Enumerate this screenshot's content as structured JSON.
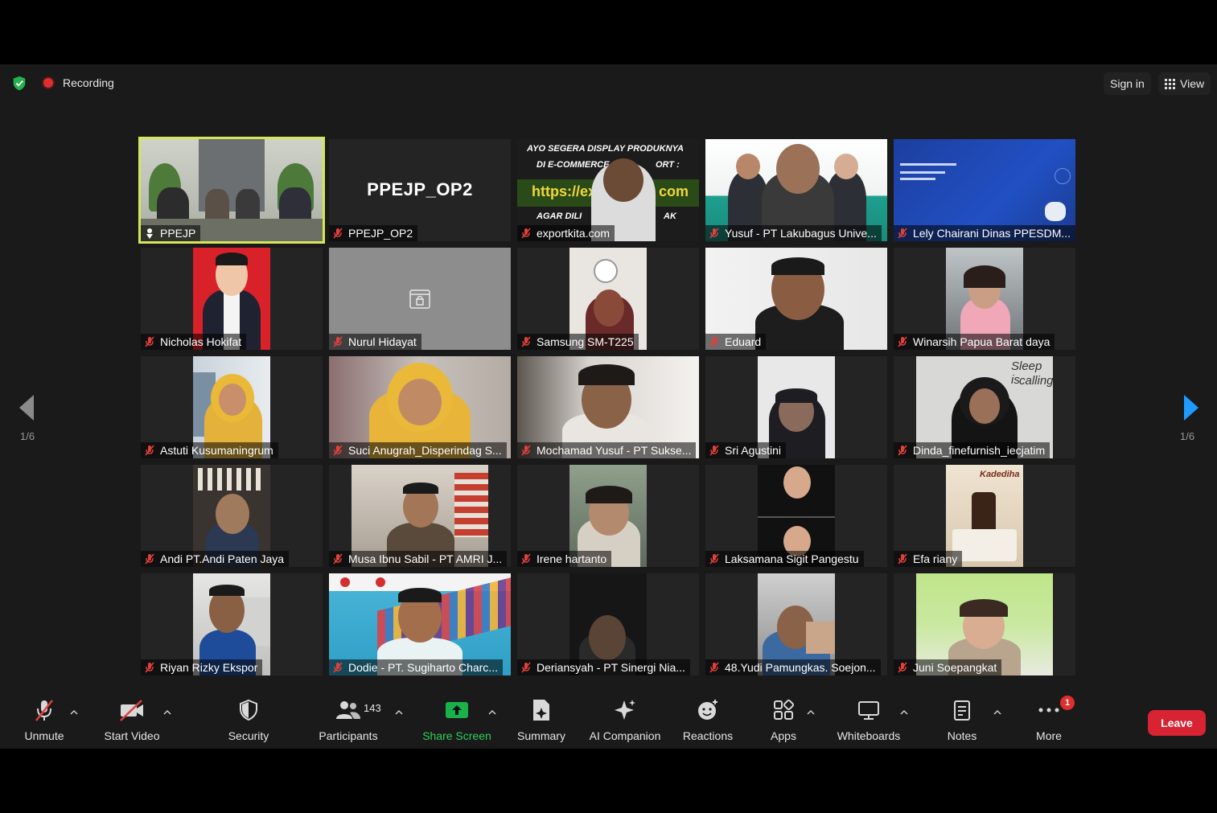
{
  "topbar": {
    "recording_label": "Recording",
    "sign_in_label": "Sign in",
    "view_label": "View"
  },
  "pagination": {
    "current": "1/6",
    "left_label": "1/6",
    "right_label": "1/6"
  },
  "participants": [
    {
      "name": "PPEJP",
      "pinned": true
    },
    {
      "name": "PPEJP_OP2",
      "display_text": "PPEJP_OP2"
    },
    {
      "name": "exportkita.com",
      "banner_line1": "AYO SEGERA DISPLAY PRODUKNYA",
      "banner_line2": "DI E-COMMERCE B2",
      "banner_line3": "ORT :",
      "banner_line4": "https://expor",
      "banner_line5": "com",
      "banner_line6": "AGAR DILI",
      "banner_line7": "AK"
    },
    {
      "name": "Yusuf - PT Lakubagus Unive..."
    },
    {
      "name": "Lely Chairani Dinas PPESDM..."
    },
    {
      "name": "Nicholas Hokifat"
    },
    {
      "name": "Nurul Hidayat"
    },
    {
      "name": "Samsung SM-T225"
    },
    {
      "name": "Eduard"
    },
    {
      "name": "Winarsih Papua Barat daya"
    },
    {
      "name": "Astuti Kusumaningrum"
    },
    {
      "name": "Suci Anugrah_Disperindag S..."
    },
    {
      "name": "Mochamad Yusuf - PT Sukse..."
    },
    {
      "name": "Sri Agustini"
    },
    {
      "name": "Dinda_finefurnish_iecjatim"
    },
    {
      "name": "Andi PT.Andi Paten Jaya"
    },
    {
      "name": "Musa Ibnu Sabil - PT AMRI J..."
    },
    {
      "name": "Irene hartanto"
    },
    {
      "name": "Laksamana Sigit Pangestu"
    },
    {
      "name": "Efa riany"
    },
    {
      "name": "Riyan Rizky Ekspor"
    },
    {
      "name": "Dodie - PT. Sugiharto Charc..."
    },
    {
      "name": "Deriansyah - PT Sinergi Nia..."
    },
    {
      "name": "48.Yudi Pamungkas. Soejon..."
    },
    {
      "name": "Juni Soepangkat"
    }
  ],
  "toolbar": {
    "unmute": "Unmute",
    "start_video": "Start Video",
    "security": "Security",
    "participants": "Participants",
    "participant_count": "143",
    "share_screen": "Share Screen",
    "summary": "Summary",
    "ai_companion": "AI Companion",
    "reactions": "Reactions",
    "apps": "Apps",
    "whiteboards": "Whiteboards",
    "notes": "Notes",
    "more": "More",
    "more_badge": "1",
    "leave": "Leave"
  },
  "colors": {
    "background": "#1a1a1a",
    "active_speaker": "#d5e65a",
    "share_green": "#2fd05a",
    "leave_red": "#d82332",
    "muted_red": "#e0403c",
    "next_arrow": "#1e9bff"
  }
}
